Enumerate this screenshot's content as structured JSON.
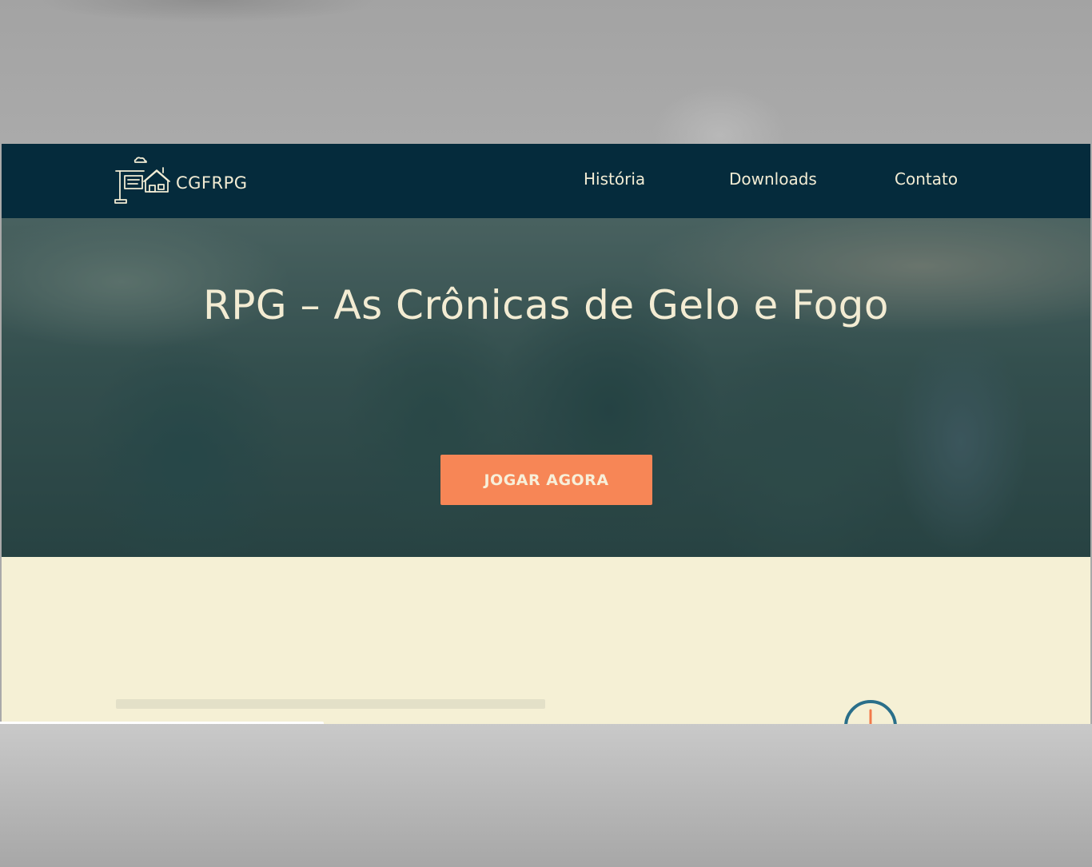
{
  "brand": {
    "name": "CGFRPG",
    "logo_icon": "signpost-house-icon"
  },
  "nav": {
    "items": [
      {
        "label": "História"
      },
      {
        "label": "Downloads"
      },
      {
        "label": "Contato"
      }
    ]
  },
  "hero": {
    "title": "RPG – As Crônicas de Gelo e Fogo",
    "cta_label": "JOGAR AGORA",
    "background": "blurred medieval warriors illustration"
  },
  "colors": {
    "navbar": "#052b3c",
    "accent": "#f78656",
    "page_background": "#f5f0d5",
    "clock_ring": "#2a6f8a",
    "clock_hand": "#f27a4a"
  },
  "content": {
    "icon": "clock-icon"
  }
}
